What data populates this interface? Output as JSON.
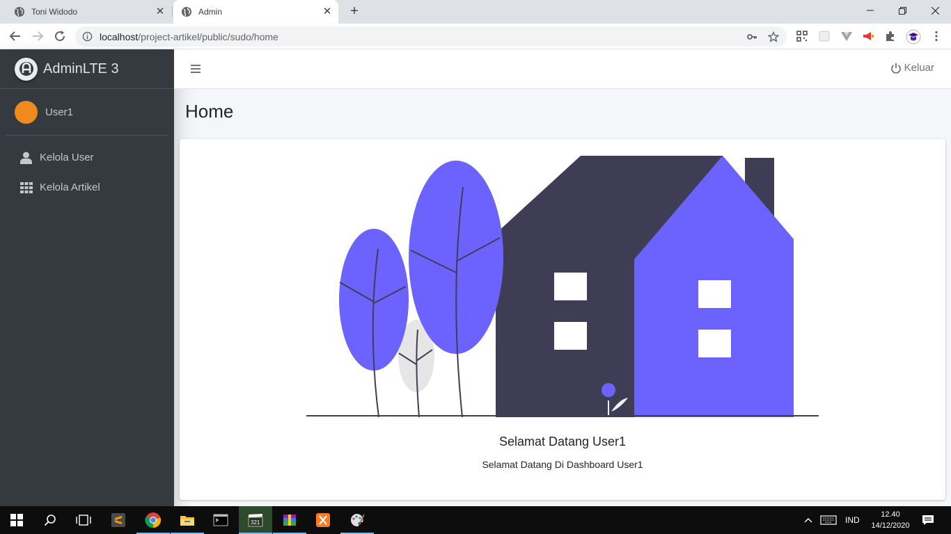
{
  "browser": {
    "tabs": [
      {
        "title": "Toni Widodo",
        "active": false
      },
      {
        "title": "Admin",
        "active": true
      }
    ],
    "url_host": "localhost",
    "url_path": "/project-artikel/public/sudo/home"
  },
  "sidebar": {
    "brand": "AdminLTE 3",
    "user_name": "User1",
    "items": [
      {
        "label": "Kelola User",
        "icon": "user-icon"
      },
      {
        "label": "Kelola Artikel",
        "icon": "grid-icon"
      }
    ]
  },
  "header": {
    "logout_label": "Keluar"
  },
  "content": {
    "page_title": "Home",
    "welcome_title": "Selamat Datang User1",
    "welcome_subtitle": "Selamat Datang Di Dashboard User1"
  },
  "taskbar": {
    "language": "IND",
    "time": "12.40",
    "date": "14/12/2020"
  },
  "colors": {
    "sidebar_bg": "#343a40",
    "accent_purple": "#6c63ff",
    "house_dark": "#3f3d56",
    "avatar_orange": "#ef8b1c"
  }
}
